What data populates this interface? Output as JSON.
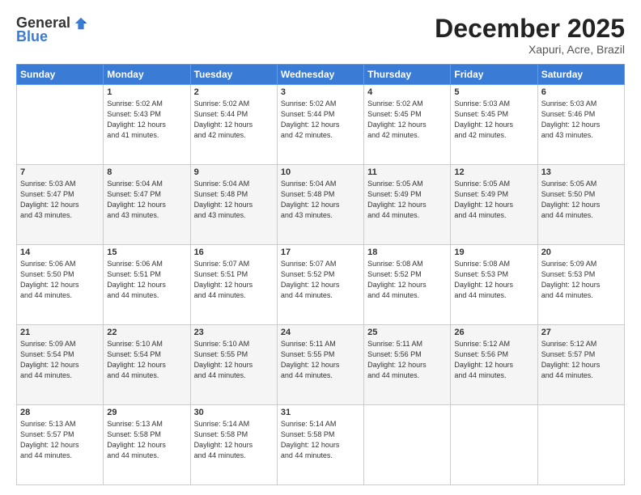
{
  "header": {
    "logo_general": "General",
    "logo_blue": "Blue",
    "month_title": "December 2025",
    "location": "Xapuri, Acre, Brazil"
  },
  "days_of_week": [
    "Sunday",
    "Monday",
    "Tuesday",
    "Wednesday",
    "Thursday",
    "Friday",
    "Saturday"
  ],
  "weeks": [
    [
      {
        "day": "",
        "info": ""
      },
      {
        "day": "1",
        "info": "Sunrise: 5:02 AM\nSunset: 5:43 PM\nDaylight: 12 hours\nand 41 minutes."
      },
      {
        "day": "2",
        "info": "Sunrise: 5:02 AM\nSunset: 5:44 PM\nDaylight: 12 hours\nand 42 minutes."
      },
      {
        "day": "3",
        "info": "Sunrise: 5:02 AM\nSunset: 5:44 PM\nDaylight: 12 hours\nand 42 minutes."
      },
      {
        "day": "4",
        "info": "Sunrise: 5:02 AM\nSunset: 5:45 PM\nDaylight: 12 hours\nand 42 minutes."
      },
      {
        "day": "5",
        "info": "Sunrise: 5:03 AM\nSunset: 5:45 PM\nDaylight: 12 hours\nand 42 minutes."
      },
      {
        "day": "6",
        "info": "Sunrise: 5:03 AM\nSunset: 5:46 PM\nDaylight: 12 hours\nand 43 minutes."
      }
    ],
    [
      {
        "day": "7",
        "info": "Sunrise: 5:03 AM\nSunset: 5:47 PM\nDaylight: 12 hours\nand 43 minutes."
      },
      {
        "day": "8",
        "info": "Sunrise: 5:04 AM\nSunset: 5:47 PM\nDaylight: 12 hours\nand 43 minutes."
      },
      {
        "day": "9",
        "info": "Sunrise: 5:04 AM\nSunset: 5:48 PM\nDaylight: 12 hours\nand 43 minutes."
      },
      {
        "day": "10",
        "info": "Sunrise: 5:04 AM\nSunset: 5:48 PM\nDaylight: 12 hours\nand 43 minutes."
      },
      {
        "day": "11",
        "info": "Sunrise: 5:05 AM\nSunset: 5:49 PM\nDaylight: 12 hours\nand 44 minutes."
      },
      {
        "day": "12",
        "info": "Sunrise: 5:05 AM\nSunset: 5:49 PM\nDaylight: 12 hours\nand 44 minutes."
      },
      {
        "day": "13",
        "info": "Sunrise: 5:05 AM\nSunset: 5:50 PM\nDaylight: 12 hours\nand 44 minutes."
      }
    ],
    [
      {
        "day": "14",
        "info": "Sunrise: 5:06 AM\nSunset: 5:50 PM\nDaylight: 12 hours\nand 44 minutes."
      },
      {
        "day": "15",
        "info": "Sunrise: 5:06 AM\nSunset: 5:51 PM\nDaylight: 12 hours\nand 44 minutes."
      },
      {
        "day": "16",
        "info": "Sunrise: 5:07 AM\nSunset: 5:51 PM\nDaylight: 12 hours\nand 44 minutes."
      },
      {
        "day": "17",
        "info": "Sunrise: 5:07 AM\nSunset: 5:52 PM\nDaylight: 12 hours\nand 44 minutes."
      },
      {
        "day": "18",
        "info": "Sunrise: 5:08 AM\nSunset: 5:52 PM\nDaylight: 12 hours\nand 44 minutes."
      },
      {
        "day": "19",
        "info": "Sunrise: 5:08 AM\nSunset: 5:53 PM\nDaylight: 12 hours\nand 44 minutes."
      },
      {
        "day": "20",
        "info": "Sunrise: 5:09 AM\nSunset: 5:53 PM\nDaylight: 12 hours\nand 44 minutes."
      }
    ],
    [
      {
        "day": "21",
        "info": "Sunrise: 5:09 AM\nSunset: 5:54 PM\nDaylight: 12 hours\nand 44 minutes."
      },
      {
        "day": "22",
        "info": "Sunrise: 5:10 AM\nSunset: 5:54 PM\nDaylight: 12 hours\nand 44 minutes."
      },
      {
        "day": "23",
        "info": "Sunrise: 5:10 AM\nSunset: 5:55 PM\nDaylight: 12 hours\nand 44 minutes."
      },
      {
        "day": "24",
        "info": "Sunrise: 5:11 AM\nSunset: 5:55 PM\nDaylight: 12 hours\nand 44 minutes."
      },
      {
        "day": "25",
        "info": "Sunrise: 5:11 AM\nSunset: 5:56 PM\nDaylight: 12 hours\nand 44 minutes."
      },
      {
        "day": "26",
        "info": "Sunrise: 5:12 AM\nSunset: 5:56 PM\nDaylight: 12 hours\nand 44 minutes."
      },
      {
        "day": "27",
        "info": "Sunrise: 5:12 AM\nSunset: 5:57 PM\nDaylight: 12 hours\nand 44 minutes."
      }
    ],
    [
      {
        "day": "28",
        "info": "Sunrise: 5:13 AM\nSunset: 5:57 PM\nDaylight: 12 hours\nand 44 minutes."
      },
      {
        "day": "29",
        "info": "Sunrise: 5:13 AM\nSunset: 5:58 PM\nDaylight: 12 hours\nand 44 minutes."
      },
      {
        "day": "30",
        "info": "Sunrise: 5:14 AM\nSunset: 5:58 PM\nDaylight: 12 hours\nand 44 minutes."
      },
      {
        "day": "31",
        "info": "Sunrise: 5:14 AM\nSunset: 5:58 PM\nDaylight: 12 hours\nand 44 minutes."
      },
      {
        "day": "",
        "info": ""
      },
      {
        "day": "",
        "info": ""
      },
      {
        "day": "",
        "info": ""
      }
    ]
  ]
}
